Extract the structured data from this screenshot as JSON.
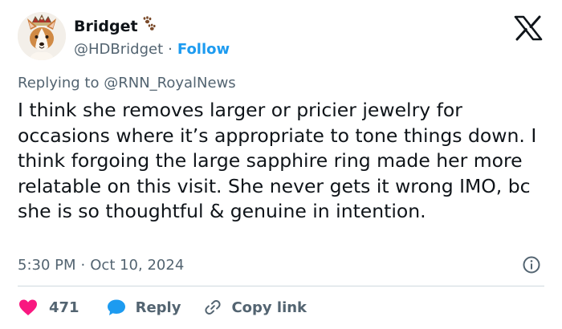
{
  "user": {
    "display_name": "Bridget",
    "handle": "@HDBridget",
    "separator": "·",
    "follow_label": "Follow",
    "avatar_icon": "corgi-with-crown",
    "badge_icon": "paw-prints"
  },
  "reply_context": {
    "prefix": "Replying to",
    "mention": "@RNN_RoyalNews"
  },
  "tweet": {
    "text": "I think she removes larger or pricier jewelry for occasions where it’s appropriate to tone things down. I think forgoing the large sapphire ring made her more relatable on this visit. She never gets it wrong IMO, bc she is so thoughtful & genuine in intention."
  },
  "meta": {
    "time": "5:30 PM",
    "separator": "·",
    "date": "Oct 10, 2024"
  },
  "actions": {
    "like_count": "471",
    "reply_label": "Reply",
    "copy_label": "Copy link"
  },
  "colors": {
    "like": "#f91880",
    "reply": "#1d9bf0",
    "link_accent": "#1d9bf0",
    "secondary_text": "#536471",
    "primary_text": "#0f1419"
  }
}
